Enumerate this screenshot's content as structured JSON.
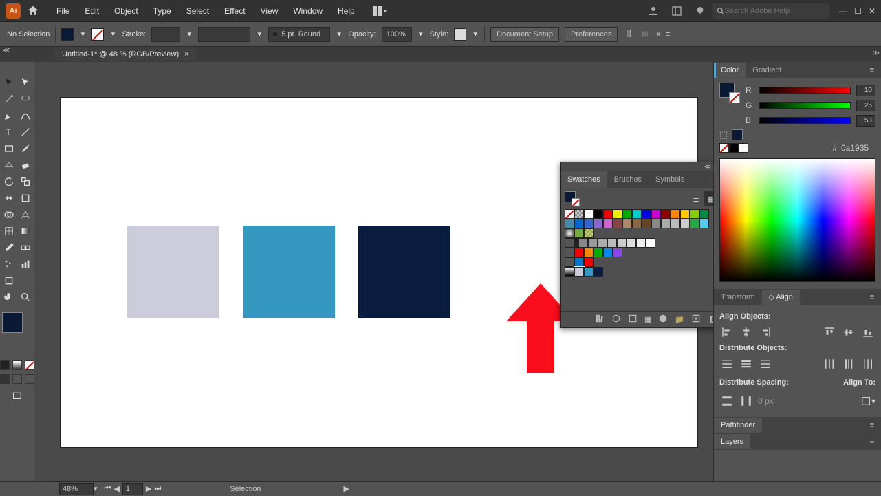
{
  "menu": {
    "items": [
      "File",
      "Edit",
      "Object",
      "Type",
      "Select",
      "Effect",
      "View",
      "Window",
      "Help"
    ]
  },
  "search_placeholder": "Search Adobe Help",
  "ctrl": {
    "selection": "No Selection",
    "stroke_label": "Stroke:",
    "stroke_weight": "5 pt. Round",
    "opacity_label": "Opacity:",
    "opacity_value": "100%",
    "style_label": "Style:",
    "btn_docsetup": "Document Setup",
    "btn_prefs": "Preferences"
  },
  "tab": {
    "title": "Untitled-1* @ 48 % (RGB/Preview)"
  },
  "fill_color": "#0a1935",
  "canvas": {
    "shape1_color": "#ccccdb",
    "shape2_color": "#3598c0",
    "shape3_color": "#0a1d40"
  },
  "swatches": {
    "tab1": "Swatches",
    "tab2": "Brushes",
    "tab3": "Symbols"
  },
  "panels": {
    "color_tab": "Color",
    "gradient_tab": "Gradient",
    "r": "R",
    "r_val": "10",
    "g": "G",
    "g_val": "25",
    "b": "B",
    "b_val": "53",
    "hex_label": "#",
    "hex_val": "0a1935",
    "transform_tab": "Transform",
    "align_tab": "Align",
    "align_objects": "Align Objects:",
    "distribute_objects": "Distribute Objects:",
    "distribute_spacing": "Distribute Spacing:",
    "align_to": "Align To:",
    "spacing_val": "0 px",
    "pathfinder_tab": "Pathfinder",
    "layers_tab": "Layers"
  },
  "status": {
    "zoom": "48%",
    "page": "1",
    "mode": "Selection"
  }
}
